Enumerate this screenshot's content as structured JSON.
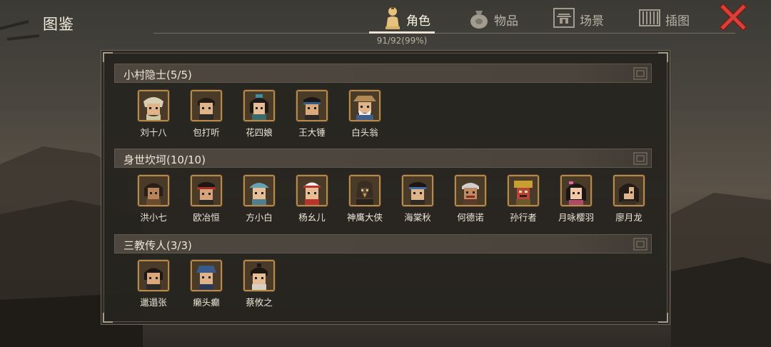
{
  "header": {
    "title": "图鉴",
    "progress": "91/92(99%)",
    "tabs": [
      {
        "label": "角色",
        "icon": "character-icon",
        "active": true
      },
      {
        "label": "物品",
        "icon": "bag-icon",
        "active": false
      },
      {
        "label": "场景",
        "icon": "scene-icon",
        "active": false
      },
      {
        "label": "插图",
        "icon": "illustration-icon",
        "active": false
      }
    ],
    "close_icon": "close-icon"
  },
  "categories": [
    {
      "title": "小村隐士(5/5)",
      "characters": [
        {
          "name": "刘十八"
        },
        {
          "name": "包打听"
        },
        {
          "name": "花四娘"
        },
        {
          "name": "王大锤"
        },
        {
          "name": "白头翁"
        }
      ]
    },
    {
      "title": "身世坎坷(10/10)",
      "characters": [
        {
          "name": "洪小七"
        },
        {
          "name": "欧冶恒"
        },
        {
          "name": "方小白"
        },
        {
          "name": "杨幺儿"
        },
        {
          "name": "神鹰大侠"
        },
        {
          "name": "海棠秋"
        },
        {
          "name": "何德诺"
        },
        {
          "name": "孙行者"
        },
        {
          "name": "月咏樱羽"
        },
        {
          "name": "廖月龙"
        }
      ]
    },
    {
      "title": "三教传人(3/3)",
      "characters": [
        {
          "name": "邋遢张"
        },
        {
          "name": "癞头癫"
        },
        {
          "name": "蔡攸之"
        }
      ]
    }
  ],
  "colors": {
    "portrait_border": "#b88a4a",
    "close_red": "#c8322d"
  }
}
